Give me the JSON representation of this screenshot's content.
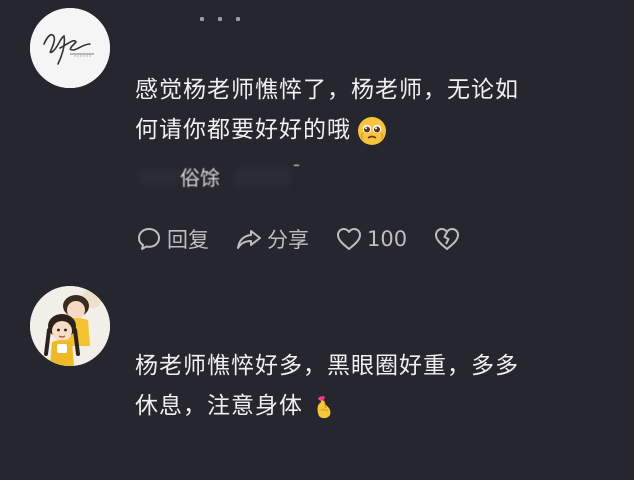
{
  "comments": [
    {
      "avatar": "signature-avatar",
      "text_line1": "感觉杨老师憔悴了，杨老师，无论如",
      "text_line2": "何请你都要好好的哦",
      "emoji": "pleading-face",
      "quote_fragment": "俗馀",
      "actions": {
        "reply_label": "回复",
        "share_label": "分享",
        "like_count": "100"
      }
    },
    {
      "avatar": "cartoon-girl-avatar",
      "text_line1": "杨老师憔悴好多，黑眼圈好重，多多",
      "text_line2": "休息，注意身体",
      "emoji": "finger-heart"
    }
  ],
  "colors": {
    "background": "#26262e",
    "text": "#f0f0f0",
    "muted": "#bdbdc2"
  }
}
